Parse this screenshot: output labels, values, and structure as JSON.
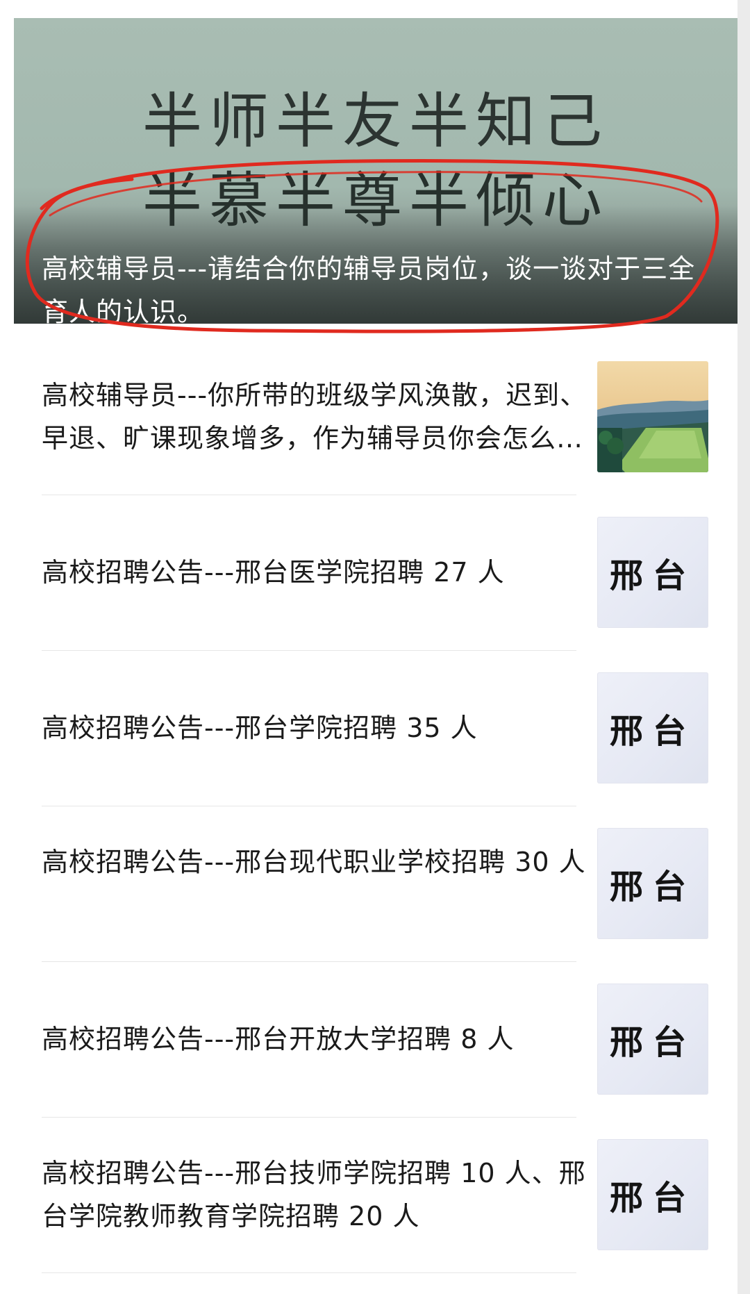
{
  "hero": {
    "quote_line1": "半师半友半知己",
    "quote_line2": "半慕半尊半倾心",
    "caption": "高校辅导员---请结合你的辅导员岗位，谈一谈对于三全育人的认识。"
  },
  "articles": [
    {
      "title": "高校辅导员---你所带的班级学风涣散，迟到、早退、旷课现象增多，作为辅导员你会怎么做？",
      "thumb": "campus-photo"
    },
    {
      "title": "高校招聘公告---邢台医学院招聘 27 人",
      "thumb_text": "邢台"
    },
    {
      "title": "高校招聘公告---邢台学院招聘 35 人",
      "thumb_text": "邢台"
    },
    {
      "title": "高校招聘公告---邢台现代职业学校招聘 30 人",
      "thumb_text": "邢台"
    },
    {
      "title": "高校招聘公告---邢台开放大学招聘 8 人",
      "thumb_text": "邢台"
    },
    {
      "title": "高校招聘公告---邢台技师学院招聘 10 人、邢台学院教师教育学院招聘 20 人",
      "thumb_text": "邢台"
    }
  ],
  "colors": {
    "annotation_ring": "#e02a1f",
    "hero_bg": "#a5b9af"
  }
}
